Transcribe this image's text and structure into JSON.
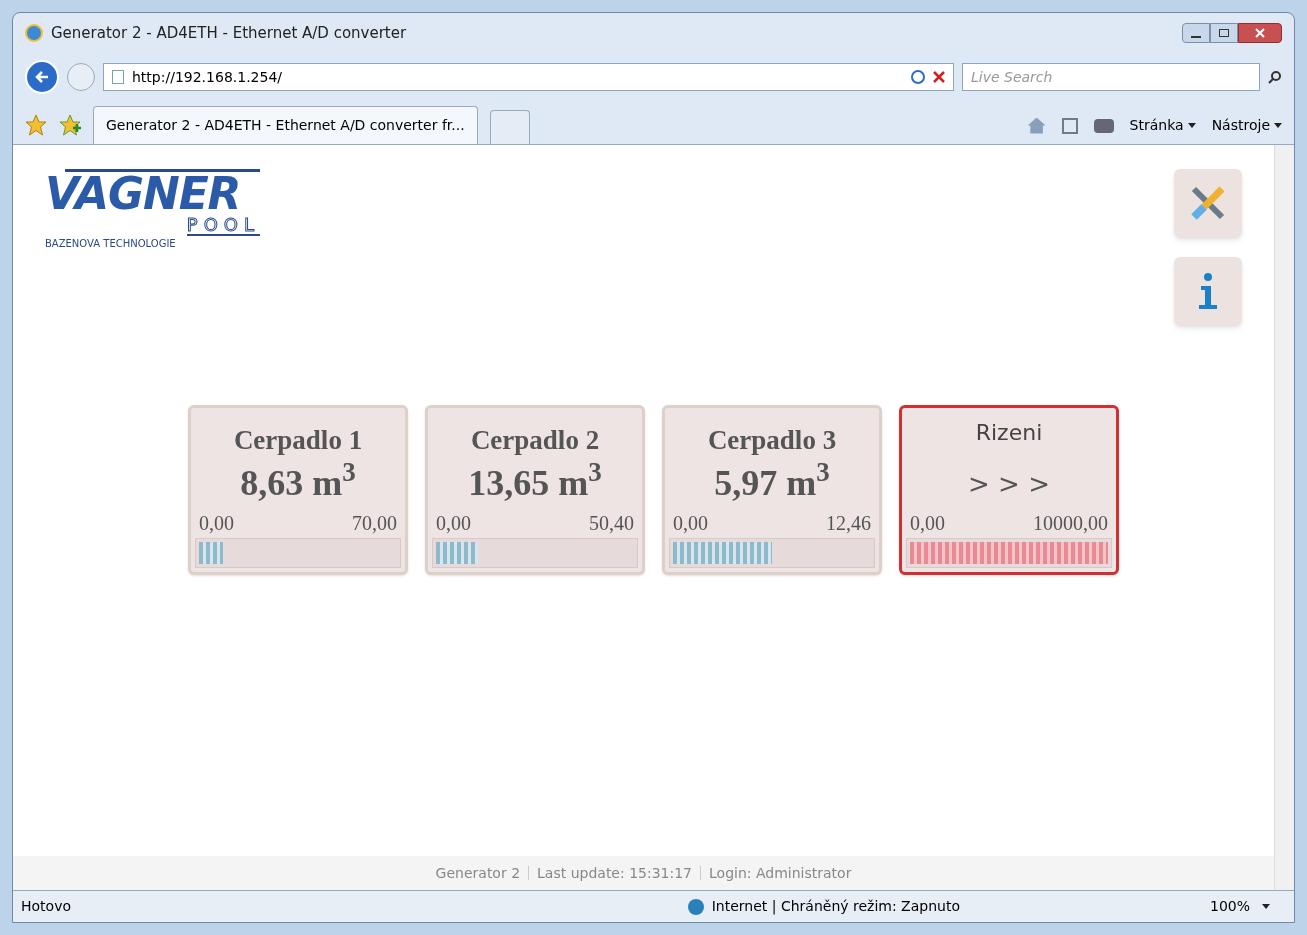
{
  "window": {
    "title": "Generator 2 - AD4ETH - Ethernet A/D converter"
  },
  "address_bar": {
    "url": "http://192.168.1.254/",
    "search_placeholder": "Live Search"
  },
  "tabs": [
    {
      "label": "Generator 2 - AD4ETH - Ethernet A/D converter fr...",
      "selected": true
    }
  ],
  "command_bar": {
    "page_menu": "Stránka",
    "tools_menu": "Nástroje"
  },
  "logo": {
    "title": "VAGNER",
    "subtitle": "POOL",
    "tagline": "BAZENOVA TECHNOLOGIE"
  },
  "gauges": [
    {
      "title": "Cerpadlo 1",
      "value": "8,63 m$^{3}$",
      "min": "0,00",
      "max": "70,00",
      "level": 0.12,
      "alert": false
    },
    {
      "title": "Cerpadlo 2",
      "value": "13,65 m$^{3}$",
      "min": "0,00",
      "max": "50,40",
      "level": 0.21,
      "alert": false
    },
    {
      "title": "Cerpadlo 3",
      "value": "5,97 m$^{3}$",
      "min": "0,00",
      "max": "12,46",
      "level": 0.5,
      "alert": false
    },
    {
      "title": "Rizeni",
      "value": "> > >",
      "min": "0,00",
      "max": "10000,00",
      "level": 1,
      "alert": true
    }
  ],
  "footer": [
    "Generator 2",
    "Last update: 15:31:17",
    "Login: Administrator"
  ],
  "status_bar": {
    "status": "Hotovo",
    "zone": "Internet | Chráněný režim: Zapnuto",
    "zoom": "100%"
  }
}
